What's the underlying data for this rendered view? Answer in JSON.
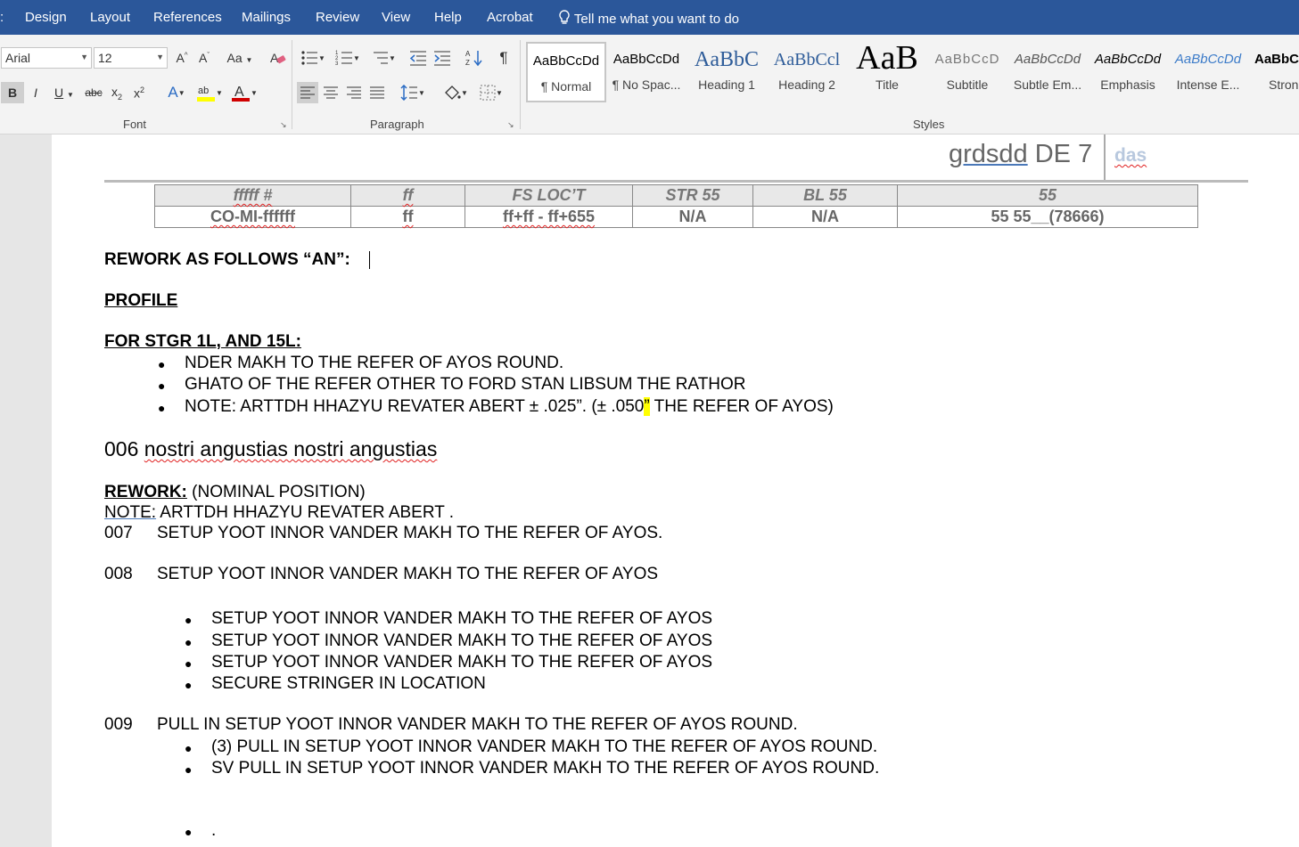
{
  "menu": {
    "items": [
      "Design",
      "Layout",
      "References",
      "Mailings",
      "Review",
      "View",
      "Help",
      "Acrobat"
    ],
    "tell_me": "Tell me what you want to do"
  },
  "font_group": {
    "font_name": "Arial",
    "font_size": "12",
    "label": "Font"
  },
  "paragraph_group": {
    "label": "Paragraph"
  },
  "styles_group": {
    "label": "Styles",
    "styles": [
      {
        "preview": "AaBbCcDd",
        "name": "¶ Normal"
      },
      {
        "preview": "AaBbCcDd",
        "name": "¶ No Spac..."
      },
      {
        "preview": "AaBbC",
        "name": "Heading 1"
      },
      {
        "preview": "AaBbCcl",
        "name": "Heading 2"
      },
      {
        "preview": "AaB",
        "name": "Title"
      },
      {
        "preview": "AaBbCcD",
        "name": "Subtitle"
      },
      {
        "preview": "AaBbCcDd",
        "name": "Subtle Em..."
      },
      {
        "preview": "AaBbCcDd",
        "name": "Emphasis"
      },
      {
        "preview": "AaBbCcDd",
        "name": "Intense E..."
      },
      {
        "preview": "AaBbC",
        "name": "Stron"
      }
    ]
  },
  "document": {
    "header": {
      "title": "grdsdd",
      "suffix": "DE 7",
      "tag": "das"
    },
    "table": {
      "headers": [
        "fffff #",
        "ff",
        "FS LOC’T",
        "STR 55",
        "BL 55",
        "55"
      ],
      "row": [
        "CO-MI-ffffff",
        "ff",
        "ff+ff - ff+655",
        "N/A",
        "N/A",
        "55 55__(78666)"
      ]
    },
    "rework_heading": "REWORK AS FOLLOWS “AN”:",
    "profile": "PROFILE",
    "for_stgr": "FOR STGR 1L, AND 15L:",
    "bullets1": [
      "NDER MAKH TO THE REFER OF AYOS ROUND.",
      "GHATO OF THE REFER OTHER TO FORD STAN LIBSUM THE RATHOR"
    ],
    "note_bullet": {
      "pre": "NOTE: ARTTDH HHAZYU REVATER ABERT ± .025”. (± .050",
      "hl": "”",
      "post": " THE REFER OF AYOS)"
    },
    "line006": {
      "num": "006",
      "text": "nostri angustias nostri angustias"
    },
    "rework_label": "REWORK:",
    "rework_text": "(NOMINAL POSITION)",
    "note_label": "NOTE:",
    "note_text": "ARTTDH HHAZYU REVATER ABERT .",
    "step007": {
      "num": "007",
      "text": "SETUP YOOT INNOR VANDER MAKH TO THE REFER OF AYOS."
    },
    "step008": {
      "num": "008",
      "text": "SETUP YOOT INNOR VANDER MAKH TO THE REFER OF AYOS"
    },
    "bullets2": [
      "SETUP YOOT INNOR VANDER MAKH TO THE REFER OF AYOS",
      "SETUP YOOT INNOR VANDER MAKH TO THE REFER OF AYOS",
      "SETUP YOOT INNOR VANDER MAKH TO THE REFER OF AYOS",
      "SECURE STRINGER IN LOCATION"
    ],
    "step009": {
      "num": "009",
      "text": "PULL IN SETUP YOOT INNOR VANDER MAKH TO THE REFER OF AYOS ROUND."
    },
    "bullets3": [
      "(3) PULL IN SETUP YOOT INNOR VANDER MAKH TO THE REFER OF AYOS ROUND.",
      "SV PULL IN SETUP YOOT INNOR VANDER MAKH TO THE REFER OF AYOS ROUND."
    ],
    "bullet_dot": "."
  }
}
